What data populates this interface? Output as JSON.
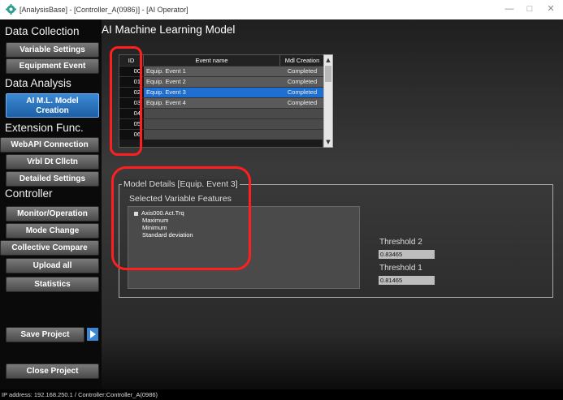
{
  "window": {
    "title": "[AnalysisBase] - [Controller_A(0986)] - [AI Operator]",
    "minimize": "—",
    "maximize": "□",
    "close": "✕"
  },
  "sidebar": {
    "data_collection": "Data Collection",
    "variable_settings": "Variable Settings",
    "equipment_event": "Equipment Event",
    "data_analysis": "Data Analysis",
    "ai_model_line1": "AI M.L. Model",
    "ai_model_line2": "Creation",
    "extension_func": "Extension Func.",
    "webapi_connection": "WebAPI Connection",
    "vrbl_dt_cllctn": "Vrbl Dt Cllctn",
    "detailed_settings": "Detailed Settings",
    "controller": "Controller",
    "monitor_operation": "Monitor/Operation",
    "mode_change": "Mode Change",
    "collective_compare": "Collective Compare",
    "upload_all": "Upload all",
    "statistics": "Statistics",
    "save_project": "Save Project",
    "close_project": "Close Project"
  },
  "main": {
    "title": "AI Machine Learning Model",
    "table": {
      "headers": [
        "ID",
        "Event name",
        "Mdl Creation"
      ],
      "rows": [
        {
          "id": "00",
          "name": "Equip. Event 1",
          "status": "Completed"
        },
        {
          "id": "01",
          "name": "Equip. Event 2",
          "status": "Completed"
        },
        {
          "id": "02",
          "name": "Equip. Event 3",
          "status": "Completed"
        },
        {
          "id": "03",
          "name": "Equip. Event 4",
          "status": "Completed"
        },
        {
          "id": "04",
          "name": "",
          "status": ""
        },
        {
          "id": "05",
          "name": "",
          "status": ""
        },
        {
          "id": "06",
          "name": "",
          "status": ""
        }
      ],
      "selected_row": 2
    },
    "details": {
      "legend": "Model Details [Equip. Event 3]",
      "features_title": "Selected Variable Features",
      "feature_root": "Axis000.Act.Trq",
      "features": [
        "Maximum",
        "Minimum",
        "Standard deviation"
      ],
      "threshold2_label": "Threshold 2",
      "threshold2_value": "0.83465",
      "threshold1_label": "Threshold 1",
      "threshold1_value": "0.81465"
    }
  },
  "status_bar": {
    "text": "IP address: 192.168.250.1 / Controller:Controller_A(0986)"
  },
  "colors": {
    "accent": "#1f6fd1",
    "highlight_ring": "#ff1f1f"
  }
}
